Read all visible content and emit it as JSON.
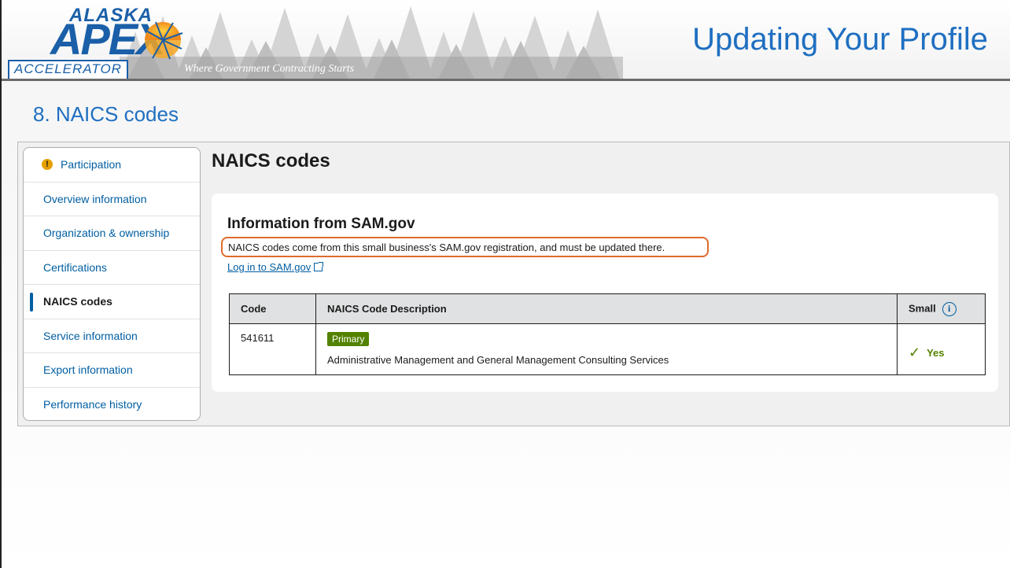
{
  "banner": {
    "logo_top": "ALASKA",
    "logo_main": "APEX",
    "logo_bottom": "ACCELERATOR",
    "tagline": "Where Government Contracting Starts",
    "title": "Updating Your Profile"
  },
  "section_heading": "8. NAICS codes",
  "sidebar": {
    "items": [
      {
        "label": "Participation",
        "icon": "warning-icon"
      },
      {
        "label": "Overview information"
      },
      {
        "label": "Organization & ownership"
      },
      {
        "label": "Certifications"
      },
      {
        "label": "NAICS codes",
        "active": true
      },
      {
        "label": "Service information"
      },
      {
        "label": "Export information"
      },
      {
        "label": "Performance history"
      }
    ]
  },
  "main": {
    "title": "NAICS codes",
    "card": {
      "heading": "Information from SAM.gov",
      "note": "NAICS codes come from this small business's SAM.gov registration, and must be updated there.",
      "link": "Log in to SAM.gov",
      "table": {
        "headers": [
          "Code",
          "NAICS Code Description",
          "Small"
        ],
        "rows": [
          {
            "code": "541611",
            "tag": "Primary",
            "description": "Administrative Management and General Management Consulting Services",
            "small": "Yes"
          }
        ]
      }
    }
  },
  "colors": {
    "accent_blue": "#1f6fc1",
    "link_blue": "#005ea2",
    "primary_tag_green": "#538200",
    "callout_orange": "#e06a2b"
  }
}
